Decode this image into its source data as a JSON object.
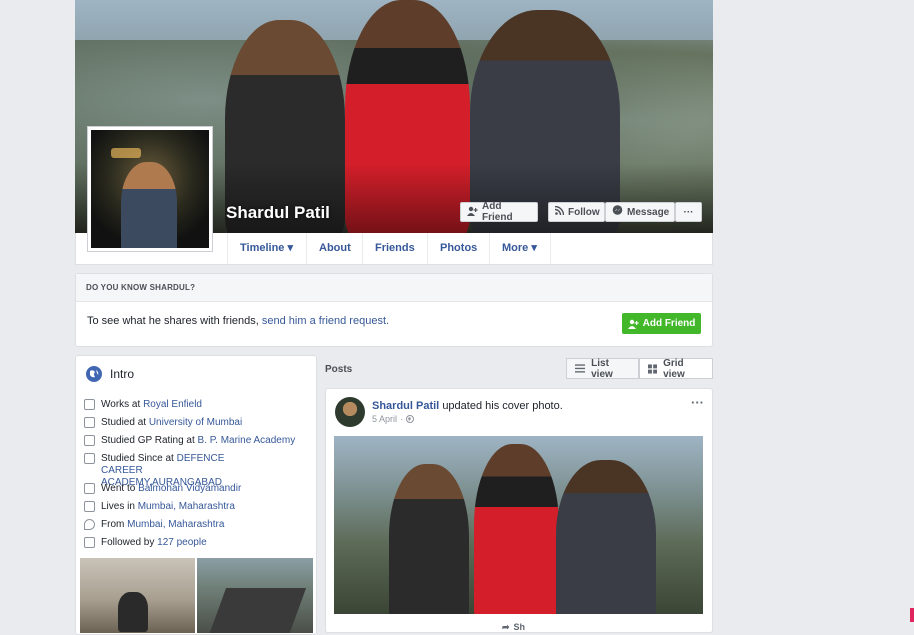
{
  "profile": {
    "name": "Shardul Patil"
  },
  "cover_actions": {
    "add_friend": "Add Friend",
    "follow": "Follow",
    "message": "Message",
    "more": "···"
  },
  "nav": {
    "tabs": [
      {
        "label": "Timeline ▾"
      },
      {
        "label": "About"
      },
      {
        "label": "Friends"
      },
      {
        "label": "Photos"
      },
      {
        "label": "More ▾"
      }
    ]
  },
  "know": {
    "header": "DO YOU KNOW SHARDUL?",
    "text": "To see what he shares with friends,",
    "link": "send him a friend request.",
    "button": "Add Friend"
  },
  "intro": {
    "title": "Intro",
    "items": [
      {
        "prefix": "Works at",
        "link": "Royal Enfield",
        "icon": "briefcase-icon"
      },
      {
        "prefix": "Studied at",
        "link": "University of Mumbai",
        "icon": "graduation-cap-icon"
      },
      {
        "prefix": "Studied GP Rating at",
        "link": "B. P. Marine Academy",
        "icon": "graduation-cap-icon"
      },
      {
        "prefix": "Studied Since at",
        "link": "DEFENCE CAREER ACADEMY,AURANGABAD",
        "icon": "graduation-cap-icon"
      },
      {
        "prefix": "Went to",
        "link": "Balmohan Vidyamandir",
        "icon": "graduation-cap-icon"
      },
      {
        "prefix": "Lives in",
        "link": "Mumbai, Maharashtra",
        "icon": "home-icon"
      },
      {
        "prefix": "From",
        "link": "Mumbai, Maharashtra",
        "icon": "location-pin-icon"
      },
      {
        "prefix": "Followed by",
        "link": "127 people",
        "icon": "followers-icon"
      }
    ]
  },
  "posts": {
    "header": "Posts",
    "list_view": "List view",
    "grid_view": "Grid view",
    "post": {
      "author": "Shardul Patil",
      "action": "updated his cover photo.",
      "date": "5 April",
      "more": "···",
      "bottom": "Sh"
    }
  },
  "colors": {
    "background": "#e9ebee",
    "link": "#365899",
    "green": "#42b72a"
  }
}
